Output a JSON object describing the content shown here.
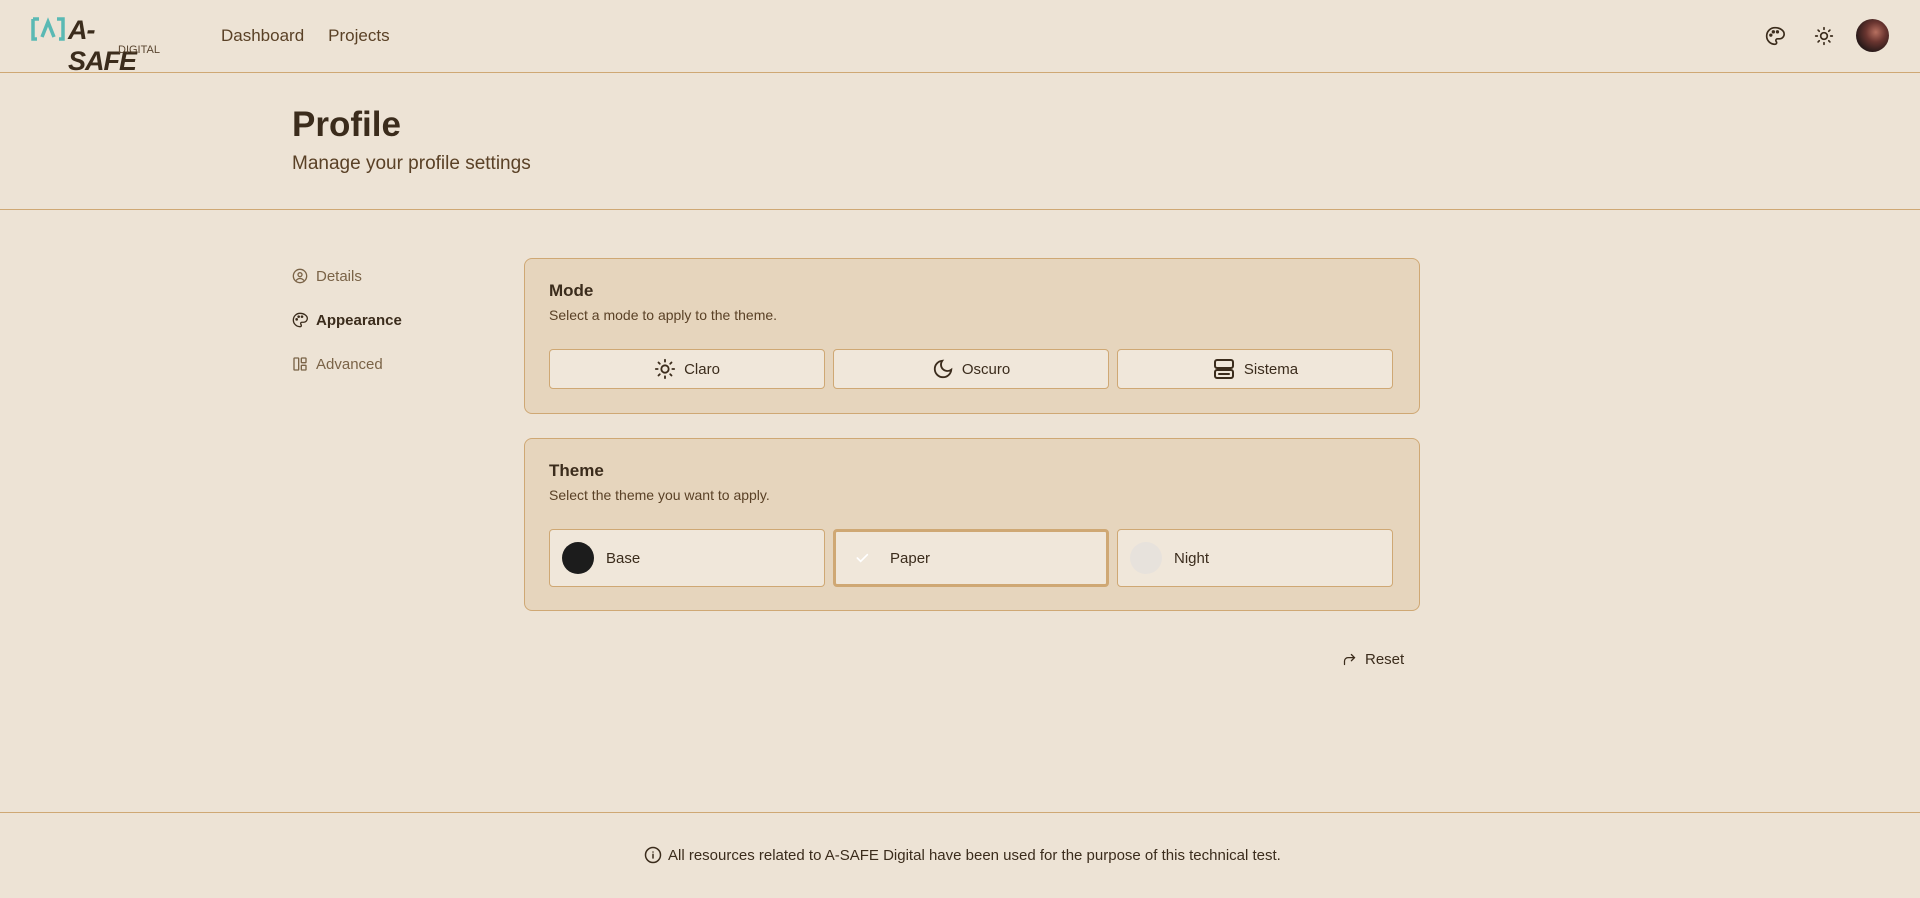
{
  "brand": {
    "name": "A-SAFE",
    "sub": "DIGITAL",
    "accent": "#5ab9b4"
  },
  "nav": {
    "items": [
      "Dashboard",
      "Projects"
    ]
  },
  "header_icons": [
    "palette-icon",
    "sun-icon"
  ],
  "page": {
    "title": "Profile",
    "subtitle": "Manage your profile settings"
  },
  "sidebar": {
    "items": [
      {
        "label": "Details",
        "icon": "user-circle-icon",
        "active": false
      },
      {
        "label": "Appearance",
        "icon": "palette-icon",
        "active": true
      },
      {
        "label": "Advanced",
        "icon": "layout-icon",
        "active": false
      }
    ]
  },
  "mode": {
    "title": "Mode",
    "description": "Select a mode to apply to the theme.",
    "options": [
      {
        "label": "Claro",
        "icon": "sun-icon"
      },
      {
        "label": "Oscuro",
        "icon": "moon-icon"
      },
      {
        "label": "Sistema",
        "icon": "server-icon"
      }
    ]
  },
  "theme": {
    "title": "Theme",
    "description": "Select the theme you want to apply.",
    "options": [
      {
        "label": "Base",
        "color": "#1c1c1c",
        "selected": false
      },
      {
        "label": "Paper",
        "color": "#f0e7da",
        "selected": true
      },
      {
        "label": "Night",
        "color": "#e7e2dc",
        "selected": false
      }
    ]
  },
  "reset": {
    "label": "Reset",
    "icon": "redo-icon"
  },
  "footer": {
    "text": "All resources related to A-SAFE Digital have been used for the purpose of this technical test.",
    "icon": "info-icon"
  }
}
